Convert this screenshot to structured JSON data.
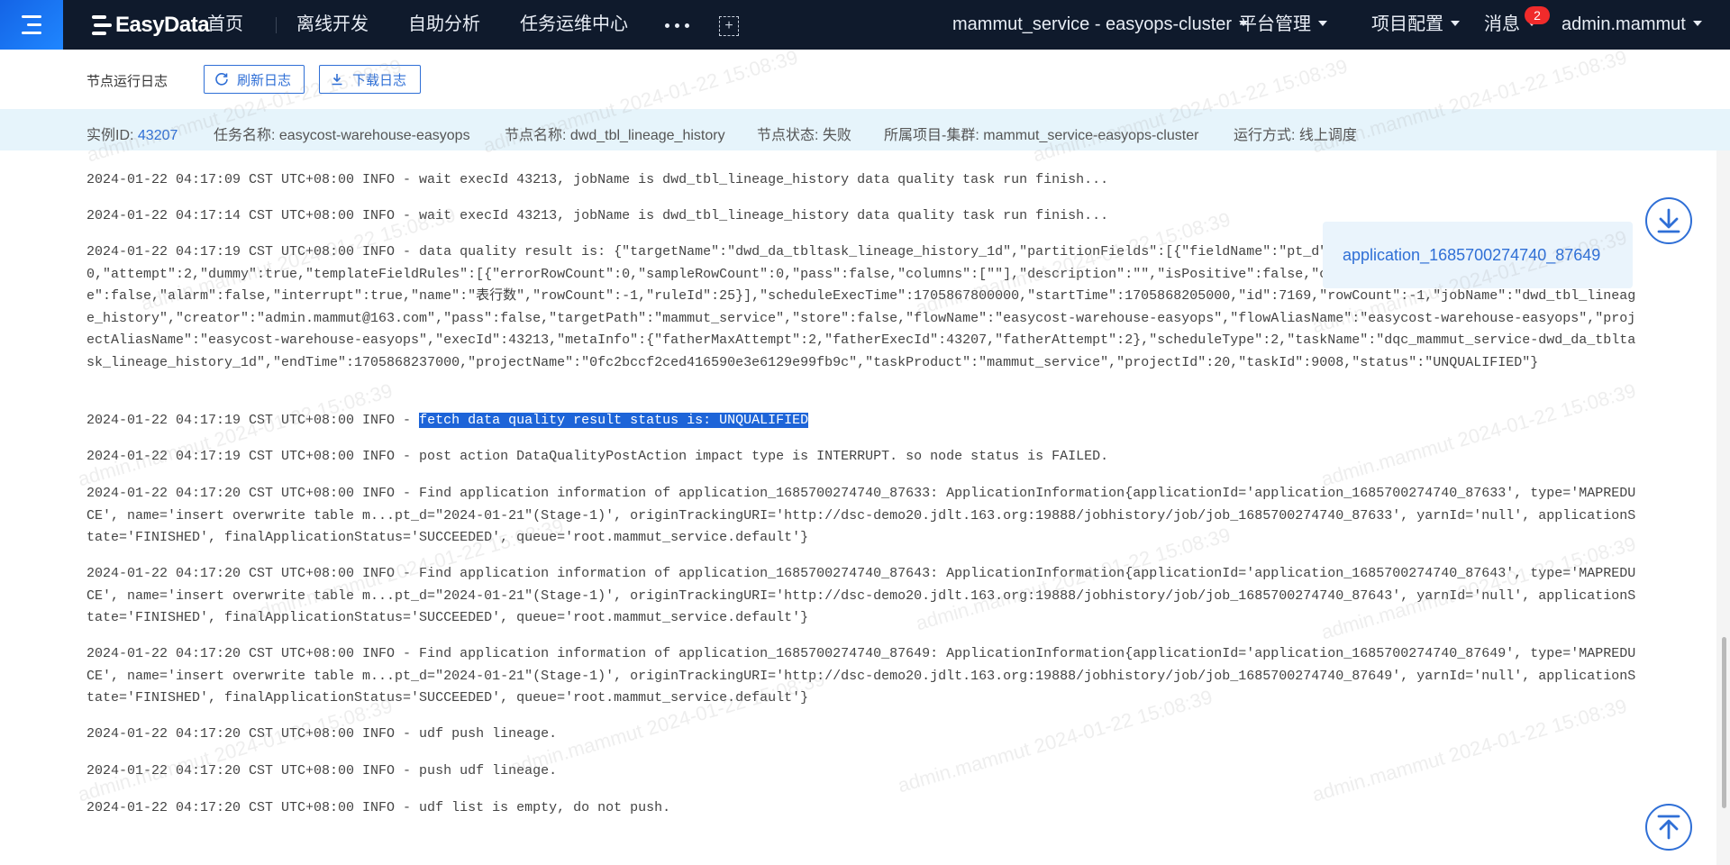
{
  "header": {
    "logo_text": "EasyData",
    "nav": [
      "首页",
      "离线开发",
      "自助分析",
      "任务运维中心"
    ],
    "project_selector": "mammut_service - easyops-cluster",
    "platform_menu": "平台管理",
    "project_menu": "项目配置",
    "messages_label": "消息",
    "messages_count": "2",
    "user_menu": "admin.mammut"
  },
  "toolbar": {
    "title": "节点运行日志",
    "refresh_label": "刷新日志",
    "download_label": "下载日志"
  },
  "info": {
    "instance_label": "实例ID:",
    "instance_value": "43207",
    "task_label": "任务名称:",
    "task_value": "easycost-warehouse-easyops",
    "node_label": "节点名称:",
    "node_value": "dwd_tbl_lineage_history",
    "status_label": "节点状态:",
    "status_value": "失败",
    "project_label": "所属项目-集群:",
    "project_value": "mammut_service-easyops-cluster",
    "mode_label": "运行方式:",
    "mode_value": "线上调度"
  },
  "log": {
    "l1": "2024-01-22 04:17:09 CST UTC+08:00 INFO - wait execId 43213, jobName is dwd_tbl_lineage_history data quality task run finish...",
    "l2": "2024-01-22 04:17:14 CST UTC+08:00 INFO - wait execId 43213, jobName is dwd_tbl_lineage_history data quality task run finish...",
    "l3": "2024-01-22 04:17:19 CST UTC+08:00 INFO - data quality result is: {\"targetName\":\"dwd_da_tbltask_lineage_history_1d\",\"partitionFields\":[{\"fieldName\":\"pt_d\",\"fieldValue\":\"2024-01-21\"}],\"type\":0,\"attempt\":2,\"dummy\":true,\"templateFieldRules\":[{\"errorRowCount\":0,\"sampleRowCount\":0,\"pass\":false,\"columns\":[\"\"],\"description\":\"\",\"isPositive\":false,\"check\":true,\"instanceId\":5173,\"disable\":false,\"alarm\":false,\"interrupt\":true,\"name\":\"表行数\",\"rowCount\":-1,\"ruleId\":25}],\"scheduleExecTime\":1705867800000,\"startTime\":1705868205000,\"id\":7169,\"rowCount\":-1,\"jobName\":\"dwd_tbl_lineage_history\",\"creator\":\"admin.mammut@163.com\",\"pass\":false,\"targetPath\":\"mammut_service\",\"store\":false,\"flowName\":\"easycost-warehouse-easyops\",\"flowAliasName\":\"easycost-warehouse-easyops\",\"projectAliasName\":\"easycost-warehouse-easyops\",\"execId\":43213,\"metaInfo\":{\"fatherMaxAttempt\":2,\"fatherExecId\":43207,\"fatherAttempt\":2},\"scheduleType\":2,\"taskName\":\"dqc_mammut_service-dwd_da_tbltask_lineage_history_1d\",\"endTime\":1705868237000,\"projectName\":\"0fc2bccf2ced416590e3e6129e99fb9c\",\"taskProduct\":\"mammut_service\",\"projectId\":20,\"taskId\":9008,\"status\":\"UNQUALIFIED\"}",
    "l4_prefix": "2024-01-22 04:17:19 CST UTC+08:00 INFO - ",
    "l4_highlight": "fetch data quality result status is: UNQUALIFIED",
    "l5": "2024-01-22 04:17:19 CST UTC+08:00 INFO - post action DataQualityPostAction impact type is INTERRUPT. so node status is FAILED.",
    "l6": "2024-01-22 04:17:20 CST UTC+08:00 INFO - Find application information of application_1685700274740_87633: ApplicationInformation{applicationId='application_1685700274740_87633', type='MAPREDUCE', name='insert overwrite table m...pt_d=\"2024-01-21\"(Stage-1)', originTrackingURI='http://dsc-demo20.jdlt.163.org:19888/jobhistory/job/job_1685700274740_87633', yarnId='null', applicationState='FINISHED', finalApplicationStatus='SUCCEEDED', queue='root.mammut_service.default'}",
    "l7": "2024-01-22 04:17:20 CST UTC+08:00 INFO - Find application information of application_1685700274740_87643: ApplicationInformation{applicationId='application_1685700274740_87643', type='MAPREDUCE', name='insert overwrite table m...pt_d=\"2024-01-21\"(Stage-1)', originTrackingURI='http://dsc-demo20.jdlt.163.org:19888/jobhistory/job/job_1685700274740_87643', yarnId='null', applicationState='FINISHED', finalApplicationStatus='SUCCEEDED', queue='root.mammut_service.default'}",
    "l8": "2024-01-22 04:17:20 CST UTC+08:00 INFO - Find application information of application_1685700274740_87649: ApplicationInformation{applicationId='application_1685700274740_87649', type='MAPREDUCE', name='insert overwrite table m...pt_d=\"2024-01-21\"(Stage-1)', originTrackingURI='http://dsc-demo20.jdlt.163.org:19888/jobhistory/job/job_1685700274740_87649', yarnId='null', applicationState='FINISHED', finalApplicationStatus='SUCCEEDED', queue='root.mammut_service.default'}",
    "l9": "2024-01-22 04:17:20 CST UTC+08:00 INFO - udf push lineage.",
    "l10": "2024-01-22 04:17:20 CST UTC+08:00 INFO - push udf lineage.",
    "l11": "2024-01-22 04:17:20 CST UTC+08:00 INFO - udf list is empty, do not push."
  },
  "tooltip": {
    "application_id": "application_1685700274740_87649"
  },
  "watermark_text": "admin.mammut 2024-01-22 15:08:39",
  "icons": {
    "menu": "menu-icon",
    "refresh": "refresh-icon",
    "download": "download-icon",
    "scroll_bottom": "arrow-down-to-line-icon",
    "scroll_top": "arrow-up-to-line-icon"
  },
  "colors": {
    "topbar": "#0f1a2c",
    "accent": "#2f6fd6",
    "infobar": "#e6f4fb",
    "badge": "#f02b2b",
    "highlight": "#1d64d8"
  }
}
